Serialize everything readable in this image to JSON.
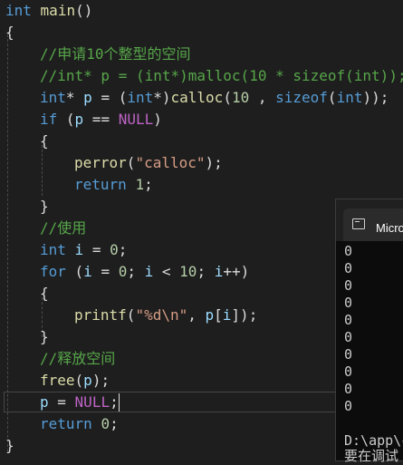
{
  "code": {
    "l1_kw": "int",
    "l1_fn": "main",
    "l1_rest": "()",
    "l2": "{",
    "l3_comment": "//申请10个整型的空间",
    "l4_comment": "//int* p = (int*)malloc(10 * sizeof(int));",
    "l5_a": "int",
    "l5_b": "* ",
    "l5_c": "p",
    "l5_d": " = (",
    "l5_e": "int",
    "l5_f": "*)",
    "l5_g": "calloc",
    "l5_h": "(",
    "l5_i": "10",
    "l5_j": " , ",
    "l5_k": "sizeof",
    "l5_l": "(",
    "l5_m": "int",
    "l5_n": "));",
    "l6_kw": "if",
    "l6_a": " (",
    "l6_var": "p",
    "l6_b": " == ",
    "l6_macro": "NULL",
    "l6_c": ")",
    "l7": "{",
    "l8_fn": "perror",
    "l8_a": "(",
    "l8_str": "\"calloc\"",
    "l8_b": ");",
    "l9_kw": "return",
    "l9_num": "1",
    "l9_end": ";",
    "l10": "}",
    "l11_comment": "//使用",
    "l12_kw": "int",
    "l12_var": "i",
    "l12_a": " = ",
    "l12_num": "0",
    "l12_end": ";",
    "l13_kw": "for",
    "l13_a": " (",
    "l13_v1": "i",
    "l13_b": " = ",
    "l13_n1": "0",
    "l13_c": "; ",
    "l13_v2": "i",
    "l13_d": " < ",
    "l13_n2": "10",
    "l13_e": "; ",
    "l13_v3": "i",
    "l13_f": "++)",
    "l14": "{",
    "l15_fn": "printf",
    "l15_a": "(",
    "l15_str": "\"%d\\n\"",
    "l15_b": ", ",
    "l15_v1": "p",
    "l15_c": "[",
    "l15_v2": "i",
    "l15_d": "]);",
    "l16": "}",
    "l17_comment": "//释放空间",
    "l18_fn": "free",
    "l18_a": "(",
    "l18_var": "p",
    "l18_b": ");",
    "l19_var": "p",
    "l19_a": " = ",
    "l19_macro": "NULL",
    "l19_b": ";",
    "l20_kw": "return",
    "l20_num": "0",
    "l20_end": ";",
    "l21": "}"
  },
  "console": {
    "title": "Micro",
    "output": [
      "0",
      "0",
      "0",
      "0",
      "0",
      "0",
      "0",
      "0",
      "0",
      "0"
    ],
    "path_line": "D:\\app\\c",
    "status_line": "要在调试"
  },
  "colors": {
    "background": "#1e1e1e",
    "keyword": "#569cd6",
    "function": "#dcdcaa",
    "comment": "#57a64a",
    "string": "#d69d85",
    "macro": "#bd63c5",
    "console_bg": "#0c0c0c"
  }
}
